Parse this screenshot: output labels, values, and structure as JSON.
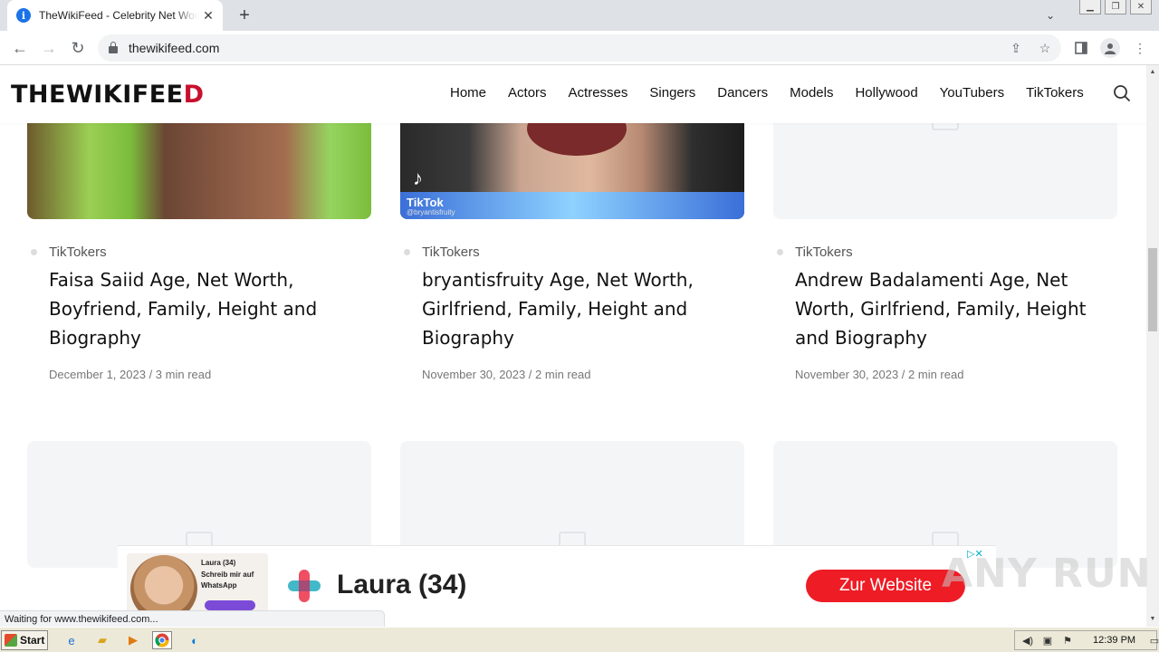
{
  "browser": {
    "tab_title": "TheWikiFeed - Celebrity Net Worth in",
    "url": "thewikifeed.com",
    "status_text": "Waiting for www.thewikifeed.com..."
  },
  "site": {
    "logo_main": "THEWIKIFEE",
    "logo_last": "D",
    "nav": [
      "Home",
      "Actors",
      "Actresses",
      "Singers",
      "Dancers",
      "Models",
      "Hollywood",
      "YouTubers",
      "TikTokers"
    ]
  },
  "cards": [
    {
      "category": "TikTokers",
      "title": "Faisa Saiid Age, Net Worth, Boyfriend, Family, Height and Biography",
      "meta": "December 1, 2023 / 3 min read"
    },
    {
      "category": "TikTokers",
      "title": "bryantisfruity Age, Net Worth, Girlfriend, Family, Height and Biography",
      "meta": "November 30, 2023 / 2 min read",
      "thumb_brand": "TikTok",
      "thumb_handle": "@bryantisfruity"
    },
    {
      "category": "TikTokers",
      "title": "Andrew Badalamenti Age, Net Worth, Girlfriend, Family, Height and Biography",
      "meta": "November 30, 2023 / 2 min read"
    }
  ],
  "ad": {
    "name": "Laura (34)",
    "small_name": "Laura (34)",
    "small_text": "Schreib mir auf WhatsApp",
    "cta": "Zur Website"
  },
  "watermark": "ANY RUN",
  "taskbar": {
    "start": "Start",
    "clock": "12:39 PM"
  },
  "colors": {
    "brand_red": "#c8102e",
    "cta_red": "#ee1c25",
    "chip_purple": "#7b4bd8"
  }
}
